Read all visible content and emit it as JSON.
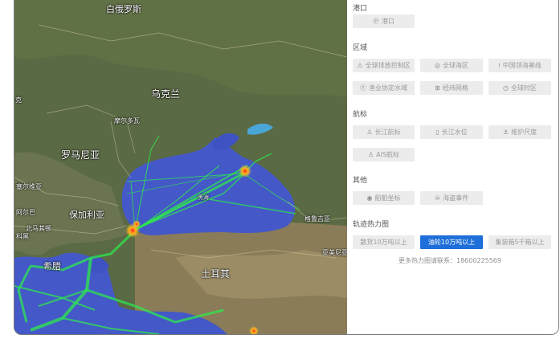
{
  "map": {
    "labels": {
      "belarus": "白俄罗斯",
      "ukraine": "乌克兰",
      "moldova": "摩尔多瓦",
      "romania": "罗马尼亚",
      "serbia": "塞尔维亚",
      "bulgaria": "保加利亚",
      "montenegro": "阿尔巴",
      "north_macedonia": "北马其顿",
      "greece": "希腊",
      "turkey": "土耳其",
      "georgia": "格鲁吉亚",
      "armenia": "亚美尼亚",
      "czech": "克",
      "macedonia_short": "科黑",
      "black_sea": "黑海"
    }
  },
  "panel": {
    "port": {
      "title": "港口",
      "items": [
        {
          "label": "港口",
          "icon": "port-icon",
          "glyph": "Ⓟ"
        }
      ]
    },
    "region": {
      "title": "区域",
      "items": [
        {
          "label": "全球排放控制区",
          "icon": "warning-icon",
          "glyph": "⚠"
        },
        {
          "label": "全球海区",
          "icon": "globe-icon",
          "glyph": "◎"
        },
        {
          "label": "中国领海基线",
          "icon": "baseline-icon",
          "glyph": "⁞"
        },
        {
          "label": "渔业协定水域",
          "icon": "fishery-icon",
          "glyph": "Ⓣ"
        },
        {
          "label": "经纬网格",
          "icon": "grid-icon",
          "glyph": "⊞"
        },
        {
          "label": "全球时区",
          "icon": "clock-icon",
          "glyph": "◷"
        }
      ]
    },
    "navigation": {
      "title": "航标",
      "items": [
        {
          "label": "长江航标",
          "icon": "buoy-icon",
          "glyph": "♙"
        },
        {
          "label": "长江水位",
          "icon": "water-level-icon",
          "glyph": "▯"
        },
        {
          "label": "维护尺度",
          "icon": "maintenance-icon",
          "glyph": "⚓"
        },
        {
          "label": "AIS航标",
          "icon": "ais-buoy-icon",
          "glyph": "♙"
        }
      ]
    },
    "other": {
      "title": "其他",
      "items": [
        {
          "label": "船舶坐标",
          "icon": "ship-position-icon",
          "glyph": "◉"
        },
        {
          "label": "海盗事件",
          "icon": "pirate-icon",
          "glyph": "☠"
        }
      ]
    },
    "heatmap": {
      "title": "轨迹热力图",
      "items": [
        {
          "label": "散货10万吨以上",
          "active": false
        },
        {
          "label": "油轮10万吨以上",
          "active": true
        },
        {
          "label": "集装箱5千箱以上",
          "active": false
        }
      ],
      "hint": "更多热力图请联系：18600225569"
    }
  },
  "colors": {
    "active": "#1e6fd9",
    "chip": "#ececec",
    "heat_low": "#2ecc40",
    "heat_high": "#ff3b1f",
    "sea": "#4056c6"
  }
}
